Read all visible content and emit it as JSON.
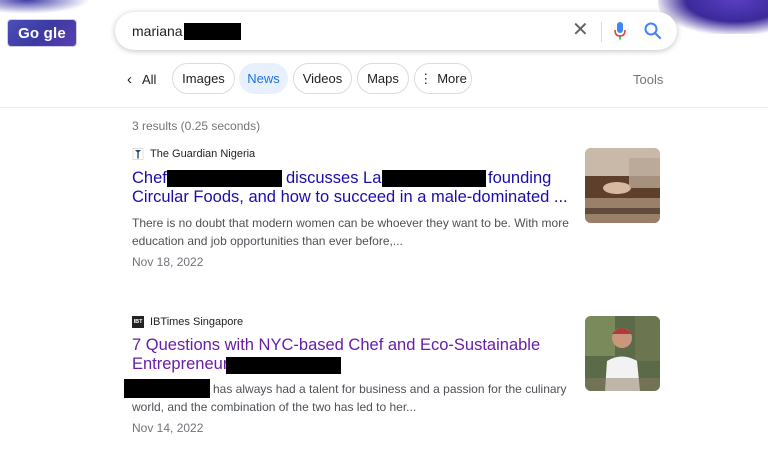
{
  "logo": {
    "text": "Go gle"
  },
  "search": {
    "query": "mariana"
  },
  "tabs": {
    "all": "All",
    "images": "Images",
    "news": "News",
    "videos": "Videos",
    "maps": "Maps",
    "more": "More",
    "tools": "Tools"
  },
  "stats": "3 results (0.25 seconds)",
  "results": [
    {
      "source": "The Guardian Nigeria",
      "title_parts": [
        "Chef",
        "discusses La",
        "founding"
      ],
      "title_line2": "Circular Foods, and how to succeed in a male-dominated ...",
      "snippet1": "There is no doubt that modern women can be whoever they want to be. With more",
      "snippet2": "education and job opportunities than ever before,...",
      "date": "Nov 18, 2022"
    },
    {
      "source": "IBTimes Singapore",
      "favicon_text": "IBT",
      "title_line1": "7 Questions with NYC-based Chef and Eco-Sustainable",
      "title_line2": "Entrepreneur",
      "snippet1": "has always had a talent for business and a passion for the culinary",
      "snippet2": "world, and the combination of the two has led to her...",
      "date": "Nov 14, 2022"
    }
  ],
  "colors": {
    "link": "#1a0dab",
    "visited": "#681da8",
    "accent": "#1a73e8"
  }
}
